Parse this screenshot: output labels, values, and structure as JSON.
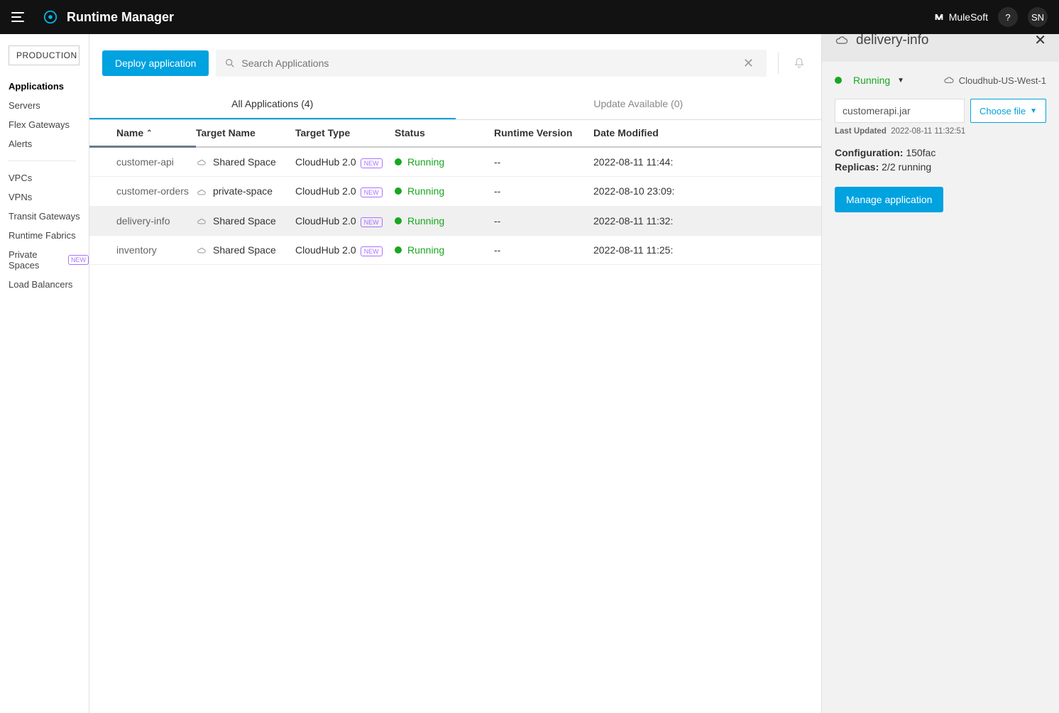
{
  "header": {
    "app_title": "Runtime Manager",
    "brand": "MuleSoft",
    "help_label": "?",
    "user_initials": "SN"
  },
  "sidebar": {
    "environment": "PRODUCTION",
    "primary": [
      {
        "label": "Applications",
        "active": true
      },
      {
        "label": "Servers"
      },
      {
        "label": "Flex Gateways"
      },
      {
        "label": "Alerts"
      }
    ],
    "secondary": [
      {
        "label": "VPCs"
      },
      {
        "label": "VPNs"
      },
      {
        "label": "Transit Gateways"
      },
      {
        "label": "Runtime Fabrics"
      },
      {
        "label": "Private Spaces",
        "badge": "NEW"
      },
      {
        "label": "Load Balancers"
      }
    ]
  },
  "toolbar": {
    "deploy_label": "Deploy application",
    "search_placeholder": "Search Applications"
  },
  "tabs": {
    "all": "All Applications (4)",
    "updates": "Update Available (0)"
  },
  "columns": {
    "name": "Name",
    "target_name": "Target Name",
    "target_type": "Target Type",
    "status": "Status",
    "runtime_version": "Runtime Version",
    "date_modified": "Date Modified"
  },
  "apps": [
    {
      "name": "customer-api",
      "target": "Shared Space",
      "type": "CloudHub 2.0",
      "type_badge": "NEW",
      "status": "Running",
      "runtime": "--",
      "date": "2022-08-11 11:44:"
    },
    {
      "name": "customer-orders",
      "target": "private-space",
      "type": "CloudHub 2.0",
      "type_badge": "NEW",
      "status": "Running",
      "runtime": "--",
      "date": "2022-08-10 23:09:"
    },
    {
      "name": "delivery-info",
      "target": "Shared Space",
      "type": "CloudHub 2.0",
      "type_badge": "NEW",
      "status": "Running",
      "runtime": "--",
      "date": "2022-08-11 11:32:",
      "selected": true
    },
    {
      "name": "inventory",
      "target": "Shared Space",
      "type": "CloudHub 2.0",
      "type_badge": "NEW",
      "status": "Running",
      "runtime": "--",
      "date": "2022-08-11 11:25:"
    }
  ],
  "detail": {
    "title": "delivery-info",
    "status": "Running",
    "location": "Cloudhub-US-West-1",
    "file_name": "customerapi.jar",
    "choose_file_label": "Choose file",
    "last_updated_label": "Last Updated",
    "last_updated_value": "2022-08-11 11:32:51",
    "config_label": "Configuration:",
    "config_value": "150fac",
    "replicas_label": "Replicas:",
    "replicas_value": "2/2 running",
    "manage_label": "Manage application"
  }
}
